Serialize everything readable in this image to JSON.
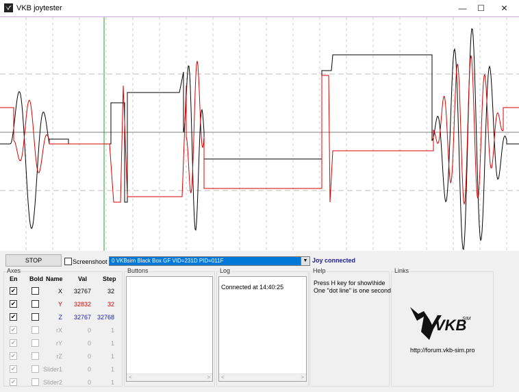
{
  "window": {
    "title": "VKB joytester",
    "minimize_glyph": "—",
    "maximize_glyph": "☐",
    "close_glyph": "✕"
  },
  "controls": {
    "stop_label": "STOP",
    "screenshoot_label": "Screenshoot",
    "screenshoot_checked": false,
    "device": "0 VKBsim Black Box GF  VID=231D PID=011F",
    "status": "Joy connected"
  },
  "axes": {
    "group_title": "Axes",
    "headers": {
      "en": "En",
      "bold": "Bold",
      "name": "Name",
      "val": "Val",
      "step": "Step"
    },
    "rows": [
      {
        "name": "X",
        "val": "32767",
        "step": "32",
        "enabled": true,
        "bold": false,
        "color": "#000000",
        "active": true
      },
      {
        "name": "Y",
        "val": "32832",
        "step": "32",
        "enabled": true,
        "bold": false,
        "color": "#e00000",
        "active": true
      },
      {
        "name": "Z",
        "val": "32767",
        "step": "32768",
        "enabled": true,
        "bold": false,
        "color": "#1b1b9e",
        "active": true
      },
      {
        "name": "rX",
        "val": "0",
        "step": "1",
        "enabled": true,
        "bold": false,
        "color": "#a0a0a0",
        "active": false
      },
      {
        "name": "rY",
        "val": "0",
        "step": "1",
        "enabled": true,
        "bold": false,
        "color": "#a0a0a0",
        "active": false
      },
      {
        "name": "rZ",
        "val": "0",
        "step": "1",
        "enabled": true,
        "bold": false,
        "color": "#a0a0a0",
        "active": false
      },
      {
        "name": "Slider1",
        "val": "0",
        "step": "1",
        "enabled": true,
        "bold": false,
        "color": "#a0a0a0",
        "active": false
      },
      {
        "name": "Slider2",
        "val": "0",
        "step": "1",
        "enabled": true,
        "bold": false,
        "color": "#a0a0a0",
        "active": false
      }
    ]
  },
  "buttons_group": {
    "title": "Buttons"
  },
  "log": {
    "title": "Log",
    "text": "Connected at 14:40:25"
  },
  "help": {
    "title": "Help",
    "line1": "Press H key for show\\hide",
    "line2": "One \"dot line\" is one second"
  },
  "links": {
    "title": "Links",
    "logo_text": "VKB",
    "logo_sup": "SIM",
    "url": "http://forum.vkb-sim.pro"
  },
  "colors": {
    "x_trace": "#000000",
    "y_trace": "#d40000",
    "accent": "#0078d7",
    "status": "#1b1b9e"
  }
}
